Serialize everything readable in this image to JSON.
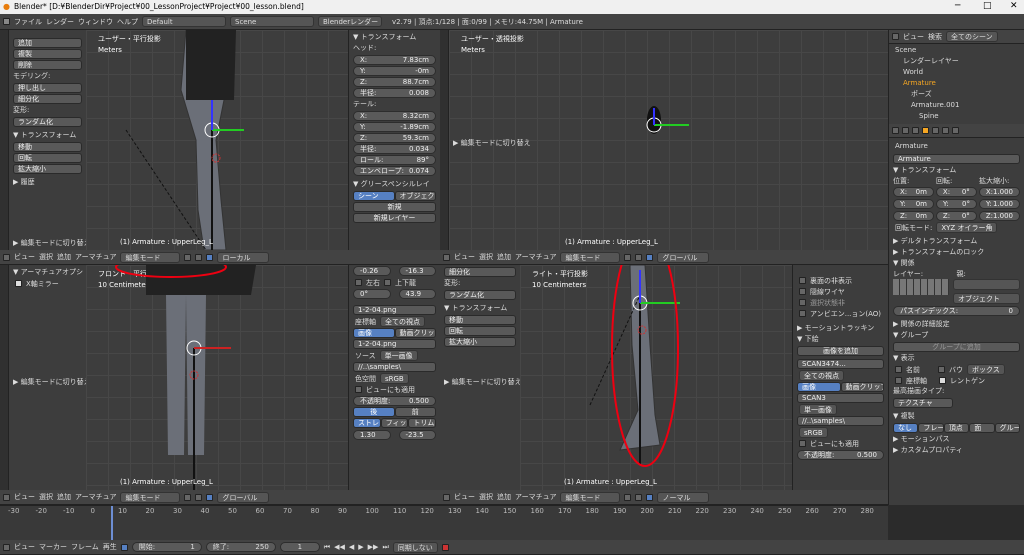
{
  "window": {
    "title": "Blender* [D:¥BlenderDir¥Project¥00_LessonProject¥Project¥00_lesson.blend]",
    "minimize": "─",
    "maximize": "□",
    "close": "✕"
  },
  "topbar": {
    "menus": [
      "ファイル",
      "レンダー",
      "ウィンドウ",
      "ヘルプ"
    ],
    "layout": "Default",
    "scene": "Scene",
    "engine": "Blenderレンダー",
    "stats": "v2.79 | 頂点:1/128 | 面:0/99 | メモリ:44.75M | Armature"
  },
  "vp_tl": {
    "label1": "ユーザー・平行投影",
    "label2": "Meters",
    "footer": "(1) Armature : UpperLeg_L"
  },
  "vp_tr": {
    "label1": "ユーザー・透視投影",
    "label2": "Meters",
    "footer": "(1) Armature : UpperLeg_L"
  },
  "vp_bl": {
    "label1": "フロント・平行投影",
    "label2": "10 Centimeters",
    "footer": "(1) Armature : UpperLeg_L"
  },
  "vp_br": {
    "label1": "ライト・平行投影",
    "label2": "10 Centimeters",
    "footer": "(1) Armature : UpperLeg_L"
  },
  "vheader": {
    "view": "ビュー",
    "select": "選択",
    "add": "追加",
    "armature": "アーマチュア",
    "mode": "編集モード",
    "local": "ローカル",
    "global": "グローバル",
    "normal": "ノーマル"
  },
  "tools_tl": {
    "add": "追加",
    "dup": "複製",
    "del": "削除",
    "modeling": "モデリング:",
    "extrude": "押し出し",
    "subdiv": "細分化",
    "deform": "変形:",
    "random": "ランダム化",
    "transform": "▼ トランスフォーム",
    "move": "移動",
    "rotate": "回転",
    "scale": "拡大縮小",
    "history": "▶ 履歴",
    "editmode": "▶ 編集モードに切り替え"
  },
  "n_tl": {
    "transform": "▼ トランスフォーム",
    "head": "ヘッド:",
    "hx": "7.83cm",
    "hy": "-0m",
    "hz": "88.7cm",
    "hr": "0.008",
    "tail": "テール:",
    "tx": "8.32cm",
    "ty": "-1.89cm",
    "tz": "59.3cm",
    "tr": "0.034",
    "roll": "89°",
    "env": "0.074",
    "envlabel": "エンベロープ:",
    "rollabel": "ロール:",
    "radius": "半径:",
    "gp": "▼ グリースペンシルレイ",
    "scene": "シーン",
    "object": "オブジェクト",
    "new": "新規",
    "newlayer": "新規レイヤー"
  },
  "tr_tools": {
    "editmode": "▶ 編集モードに切り替え"
  },
  "bl_tools": {
    "armopt": "▼ アーマチュアオプシ",
    "xmirror": "X軸ミラー",
    "editmode": "▶ 編集モードに切り替え"
  },
  "n_bl": {
    "v1": "-0.26",
    "v2": "-16.3",
    "left": "左右",
    "topbot": "上下龍",
    "v3": "0°",
    "v4": "43.9",
    "img": "1-2-04.png",
    "axis": "座標軸",
    "front": "全ての視点",
    "image": "画像",
    "movie": "動画クリップ",
    "src": "ソース",
    "single": "単一画像",
    "path": "//..\\samples\\",
    "colorspace": "色空間",
    "srgb": "sRGB",
    "viewalso": "ビューにも適用",
    "opacity": "不透明度:",
    "opv": "0.500",
    "back": "後",
    "front2": "前",
    "stretch": "ストレ",
    "fit": "フィット",
    "crop": "トリム",
    "x": "1.30",
    "y": "-23.5"
  },
  "br_tools": {
    "subdiv": "細分化",
    "deform": "変形:",
    "random": "ランダム化",
    "transform": "▼ トランスフォーム",
    "move": "移動",
    "rotate": "回転",
    "scale": "拡大縮小",
    "editmode": "▶ 編集モードに切り替え"
  },
  "n_br": {
    "back": "裏面の非表示",
    "wire": "隠線ワイヤ",
    "noselect": "選択状態非",
    "ao": "アンビエン...ョン(AO)",
    "motion": "▶ モーショントラッキン",
    "bg": "▼ 下絵",
    "addimg": "画像を追加",
    "scan": "SCAN3474...",
    "allview": "全ての視点",
    "image": "画像",
    "movie": "動画クリップ",
    "scanname": "SCAN3",
    "single": "単一画像",
    "path": "//..\\samples\\",
    "srgb": "sRGB",
    "viewalso": "ビューにも適用",
    "opacity": "不透明度:",
    "opv": "0.500"
  },
  "outliner": {
    "view": "ビュー",
    "search": "検索",
    "allscenes": "全てのシーン",
    "items": [
      "Scene",
      "レンダーレイヤー",
      "World",
      "Armature",
      "ポーズ",
      "Armature.001",
      "Spine"
    ]
  },
  "props": {
    "name": "Armature",
    "transform": "▼ トランスフォーム",
    "pos": "位置:",
    "rot": "回転:",
    "scale": "拡大縮小:",
    "px": "0m",
    "py": "0m",
    "pz": "0m",
    "rx": "0°",
    "ry": "0°",
    "rz": "0°",
    "sx": "1.000",
    "sy": "1.000",
    "sz": "1.000",
    "rotmode": "回転モード:",
    "euler": "XYZ オイラー角",
    "delta": "▶ デルタトランスフォーム",
    "lock": "▶ トランスフォームのロック",
    "rel": "▼ 関係",
    "layer": "レイヤー:",
    "parent": "親:",
    "object": "オブジェクト",
    "passindex": "パスインデックス:",
    "passv": "0",
    "relext": "▶ 関係の詳細設定",
    "groups": "▼ グループ",
    "addgroup": "グループに追加",
    "display": "▼ 表示",
    "name2": "名前",
    "bounds": "バウ",
    "boundsv": "ボックス",
    "axes": "座標軸",
    "xray": "レントゲン",
    "maxdraw": "最高描画タイプ:",
    "texture": "テクスチャ",
    "dup": "▼ 複製",
    "none": "なし",
    "frames": "フレーム",
    "verts": "頂点",
    "faces": "面",
    "group": "グループ",
    "motionpath": "▶ モーションパス",
    "custom": "▶ カスタムプロパティ"
  },
  "timeline": {
    "view": "ビュー",
    "marker": "マーカー",
    "frame": "フレーム",
    "play": "再生",
    "start": "開始:",
    "startv": "1",
    "end": "終了:",
    "endv": "250",
    "current": "1",
    "sync": "同期しない",
    "ticks": [
      "-30",
      "-20",
      "-10",
      "0",
      "10",
      "20",
      "30",
      "40",
      "50",
      "60",
      "70",
      "80",
      "90",
      "100",
      "110",
      "120",
      "130",
      "140",
      "150",
      "160",
      "170",
      "180",
      "190",
      "200",
      "210",
      "220",
      "230",
      "240",
      "250",
      "260",
      "270",
      "280"
    ]
  }
}
